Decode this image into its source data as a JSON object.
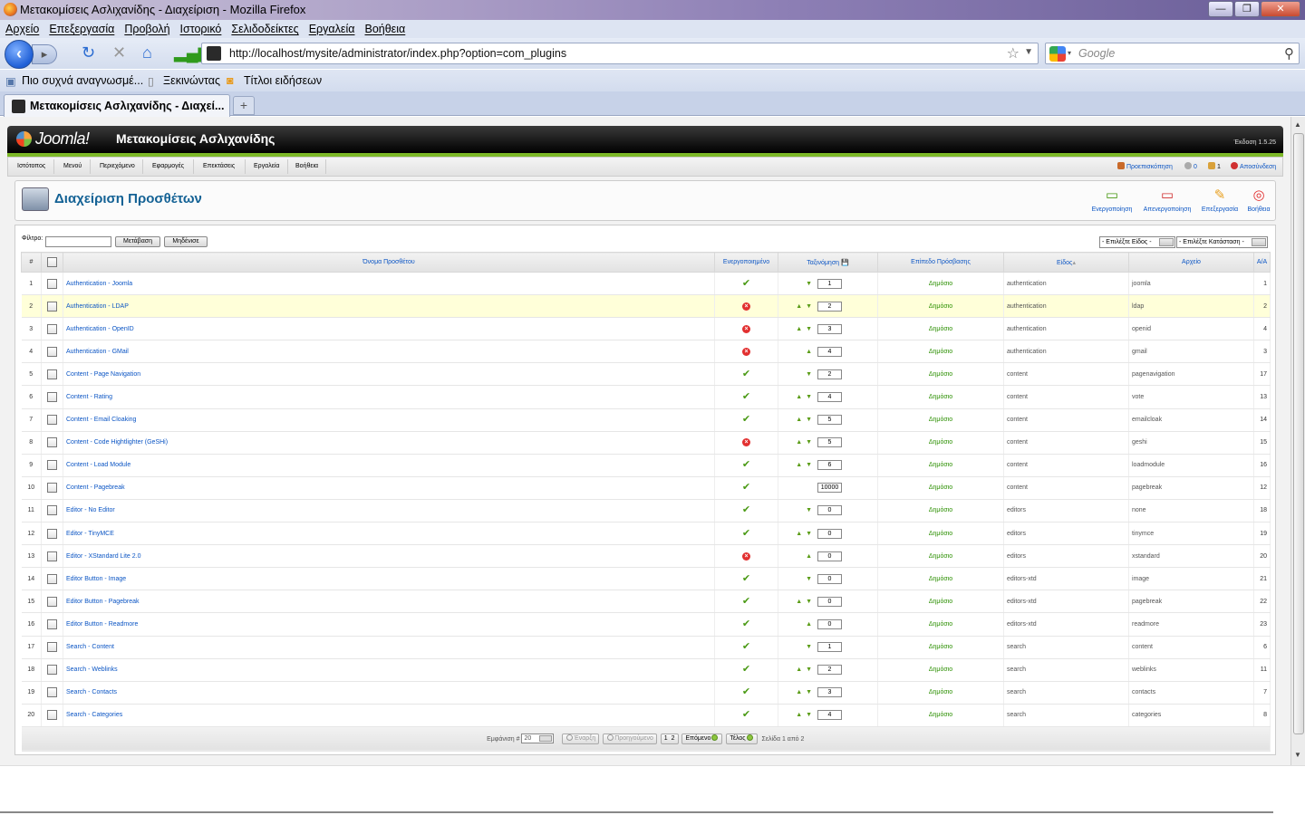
{
  "window": {
    "title": "Μετακομίσεις Ασλιχανίδης - Διαχείριση - Mozilla Firefox"
  },
  "menu": [
    "Αρχείο",
    "Επεξεργασία",
    "Προβολή",
    "Ιστορικό",
    "Σελιδοδείκτες",
    "Εργαλεία",
    "Βοήθεια"
  ],
  "nav": {
    "url": "http://localhost/mysite/administrator/index.php?option=com_plugins",
    "search_placeholder": "Google"
  },
  "bookmarks": [
    "Πιο συχνά αναγνωσμέ...",
    "Ξεκινώντας",
    "Τίτλοι ειδήσεων"
  ],
  "tab": {
    "label": "Μετακομίσεις Ασλιχανίδης - Διαχεί..."
  },
  "joomla": {
    "logo": "Joomla!",
    "site_name": "Μετακομίσεις Ασλιχανίδης",
    "version": "Έκδοση 1.5.25"
  },
  "admin_menu": [
    "Ιστότοπος",
    "Μενού",
    "Περιεχόμενο",
    "Εφαρμογές",
    "Επεκτάσεις",
    "Εργαλεία",
    "Βοήθεια"
  ],
  "admin_status": {
    "preview": "Προεπισκόπηση",
    "visitors": "0",
    "users": "1",
    "logout": "Αποσύνδεση"
  },
  "page": {
    "title": "Διαχείριση Προσθέτων"
  },
  "toolbar": {
    "enable": "Ενεργοποίηση",
    "disable": "Απενεργοποίηση",
    "edit": "Επεξεργασία",
    "help": "Βοήθεια"
  },
  "filter": {
    "label": "Φίλτρο:",
    "go": "Μετάβαση",
    "reset": "Μηδένισε",
    "type_select": "- Επιλέξτε Είδος -",
    "state_select": "- Επιλέξτε Κατάσταση -"
  },
  "columns": {
    "num": "#",
    "name": "Όνομα Προσθέτου",
    "enabled": "Ενεργοποιημένο",
    "ordering": "Ταξινόμηση",
    "access": "Επίπεδο Πρόσβασης",
    "type": "Είδος",
    "file": "Αρχείο",
    "id": "Α/Α"
  },
  "colors": {
    "link": "#0b55c4",
    "green": "#7cb827",
    "highlight": "#ffffd9"
  },
  "rows": [
    {
      "n": "1",
      "name": "Authentication - Joomla",
      "enabled": true,
      "up": false,
      "down": true,
      "order": "1",
      "access": "Δημόσιο",
      "type": "authentication",
      "file": "joomla",
      "id": "1"
    },
    {
      "n": "2",
      "name": "Authentication - LDAP",
      "enabled": false,
      "up": true,
      "down": true,
      "order": "2",
      "access": "Δημόσιο",
      "type": "authentication",
      "file": "ldap",
      "id": "2"
    },
    {
      "n": "3",
      "name": "Authentication - OpenID",
      "enabled": false,
      "up": true,
      "down": true,
      "order": "3",
      "access": "Δημόσιο",
      "type": "authentication",
      "file": "openid",
      "id": "4"
    },
    {
      "n": "4",
      "name": "Authentication - GMail",
      "enabled": false,
      "up": true,
      "down": false,
      "order": "4",
      "access": "Δημόσιο",
      "type": "authentication",
      "file": "gmail",
      "id": "3"
    },
    {
      "n": "5",
      "name": "Content - Page Navigation",
      "enabled": true,
      "up": false,
      "down": true,
      "order": "2",
      "access": "Δημόσιο",
      "type": "content",
      "file": "pagenavigation",
      "id": "17"
    },
    {
      "n": "6",
      "name": "Content - Rating",
      "enabled": true,
      "up": true,
      "down": true,
      "order": "4",
      "access": "Δημόσιο",
      "type": "content",
      "file": "vote",
      "id": "13"
    },
    {
      "n": "7",
      "name": "Content - Email Cloaking",
      "enabled": true,
      "up": true,
      "down": true,
      "order": "5",
      "access": "Δημόσιο",
      "type": "content",
      "file": "emailcloak",
      "id": "14"
    },
    {
      "n": "8",
      "name": "Content - Code Hightlighter (GeSHi)",
      "enabled": false,
      "up": true,
      "down": true,
      "order": "5",
      "access": "Δημόσιο",
      "type": "content",
      "file": "geshi",
      "id": "15"
    },
    {
      "n": "9",
      "name": "Content - Load Module",
      "enabled": true,
      "up": true,
      "down": true,
      "order": "6",
      "access": "Δημόσιο",
      "type": "content",
      "file": "loadmodule",
      "id": "16"
    },
    {
      "n": "10",
      "name": "Content - Pagebreak",
      "enabled": true,
      "up": false,
      "down": false,
      "order": "10000",
      "access": "Δημόσιο",
      "type": "content",
      "file": "pagebreak",
      "id": "12"
    },
    {
      "n": "11",
      "name": "Editor - No Editor",
      "enabled": true,
      "up": false,
      "down": true,
      "order": "0",
      "access": "Δημόσιο",
      "type": "editors",
      "file": "none",
      "id": "18"
    },
    {
      "n": "12",
      "name": "Editor - TinyMCE",
      "enabled": true,
      "up": true,
      "down": true,
      "order": "0",
      "access": "Δημόσιο",
      "type": "editors",
      "file": "tinymce",
      "id": "19"
    },
    {
      "n": "13",
      "name": "Editor - XStandard Lite 2.0",
      "enabled": false,
      "up": true,
      "down": false,
      "order": "0",
      "access": "Δημόσιο",
      "type": "editors",
      "file": "xstandard",
      "id": "20"
    },
    {
      "n": "14",
      "name": "Editor Button - Image",
      "enabled": true,
      "up": false,
      "down": true,
      "order": "0",
      "access": "Δημόσιο",
      "type": "editors-xtd",
      "file": "image",
      "id": "21"
    },
    {
      "n": "15",
      "name": "Editor Button - Pagebreak",
      "enabled": true,
      "up": true,
      "down": true,
      "order": "0",
      "access": "Δημόσιο",
      "type": "editors-xtd",
      "file": "pagebreak",
      "id": "22"
    },
    {
      "n": "16",
      "name": "Editor Button - Readmore",
      "enabled": true,
      "up": true,
      "down": false,
      "order": "0",
      "access": "Δημόσιο",
      "type": "editors-xtd",
      "file": "readmore",
      "id": "23"
    },
    {
      "n": "17",
      "name": "Search - Content",
      "enabled": true,
      "up": false,
      "down": true,
      "order": "1",
      "access": "Δημόσιο",
      "type": "search",
      "file": "content",
      "id": "6"
    },
    {
      "n": "18",
      "name": "Search - Weblinks",
      "enabled": true,
      "up": true,
      "down": true,
      "order": "2",
      "access": "Δημόσιο",
      "type": "search",
      "file": "weblinks",
      "id": "11"
    },
    {
      "n": "19",
      "name": "Search - Contacts",
      "enabled": true,
      "up": true,
      "down": true,
      "order": "3",
      "access": "Δημόσιο",
      "type": "search",
      "file": "contacts",
      "id": "7"
    },
    {
      "n": "20",
      "name": "Search - Categories",
      "enabled": true,
      "up": true,
      "down": true,
      "order": "4",
      "access": "Δημόσιο",
      "type": "search",
      "file": "categories",
      "id": "8"
    }
  ],
  "pagination": {
    "display_label": "Εμφάνιση #",
    "display_value": "20",
    "start": "Έναρξη",
    "prev": "Προηγούμενο",
    "pages": [
      "1",
      "2"
    ],
    "next": "Επόμενο",
    "end": "Τέλος",
    "page_info": "Σελίδα 1 από 2"
  }
}
